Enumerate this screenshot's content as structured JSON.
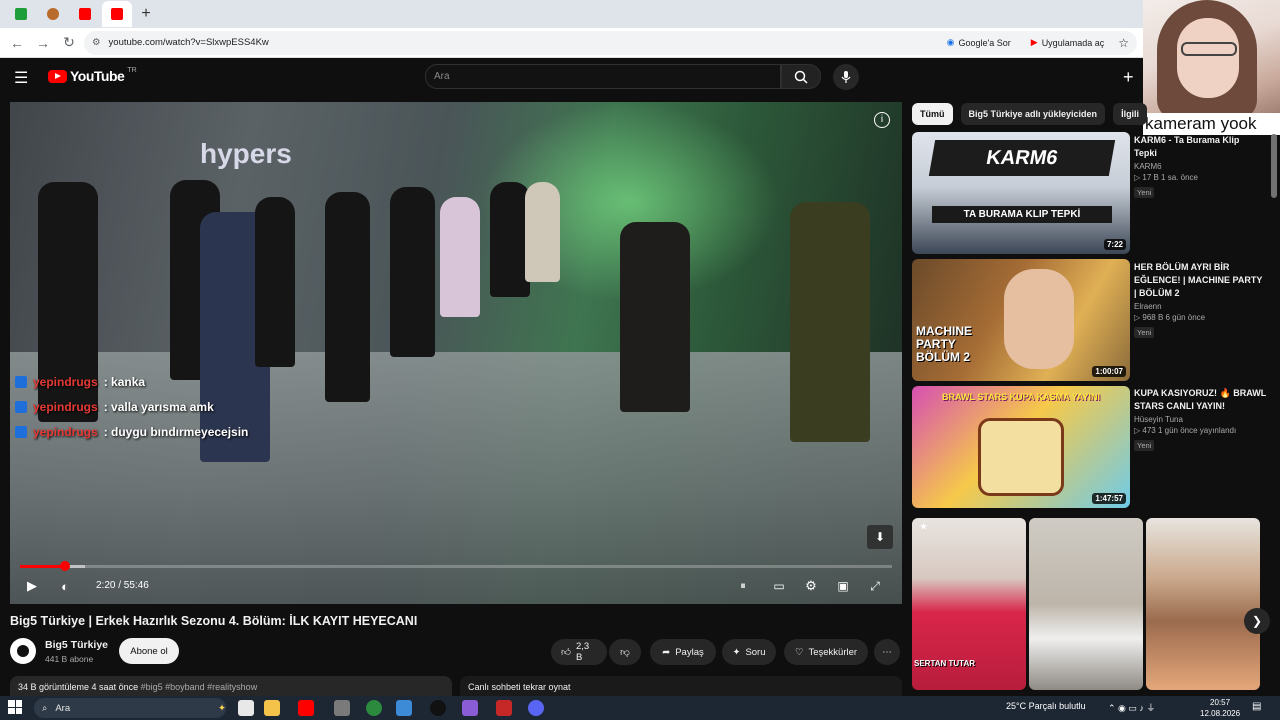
{
  "browser": {
    "url": "youtube.com/watch?v=SlxwpESS4Kw",
    "ask_google": "Google'a Sor",
    "open_in_app": "Uygulamada aç"
  },
  "webcam": {
    "overlay_text": "kameram yook"
  },
  "header": {
    "logo": "YouTube",
    "country_code": "TR",
    "search_placeholder": "Ara"
  },
  "player": {
    "time": "2:20 / 55:46",
    "progress": 0.042,
    "chat": [
      {
        "user": "yepindrugs",
        "message": ": kanka"
      },
      {
        "user": "yepindrugs",
        "message": ": valla yarısma amk"
      },
      {
        "user": "yepindrugs",
        "message": ": duygu bındırmeyecejsin"
      }
    ]
  },
  "video": {
    "title": "Big5 Türkiye | Erkek Hazırlık Sezonu 4. Bölüm: İLK KAYIT HEYECANI",
    "channel": "Big5 Türkiye",
    "subscribers": "441 B abone",
    "subscribe_label": "Abone ol",
    "likes": "2,3 B",
    "share": "Paylaş",
    "ask": "Soru",
    "thanks": "Teşekkürler",
    "views_time": "34 B görüntüleme  4 saat önce",
    "tags": "#big5 #boyband #realityshow",
    "chat_replay": "Canlı sohbeti tekrar oynat"
  },
  "chips": [
    "Tümü",
    "Big5 Türkiye adlı yükleyiciden",
    "İlgili"
  ],
  "recommendations": [
    {
      "title_line1": "KARM6 - Ta Burama Klip",
      "title_line2": "Tepki",
      "channel": "KARM6",
      "meta": "▷ 17 B   1 sa. önce",
      "badge": "Yeni",
      "duration": "7:22",
      "thumb_text": "TA BURAMA KLIP TEPKİ"
    },
    {
      "title_line1": "HER BÖLÜM AYRI BİR EĞLENCE! | MACHINE PARTY",
      "title_line2": "| BÖLÜM 2",
      "channel": "Elraenn",
      "meta": "▷ 968 B   6 gün önce",
      "badge": "Yeni",
      "duration": "1:00:07",
      "thumb_text": "MACHINE PARTY BÖLÜM 2"
    },
    {
      "title_line1": "KUPA KASIYORUZ! 🔥 BRAWL",
      "title_line2": "STARS CANLI YAYIN!",
      "channel": "Hüseyin Tuna",
      "meta": "▷ 473   1 gün önce yayınlandı",
      "badge": "Yeni",
      "duration": "1:47:57",
      "thumb_text": "BRAWL STARS KUPA KASMA YAYINI"
    }
  ],
  "shorts": [
    {
      "label": "SERTAN TUTAR"
    },
    {
      "label": ""
    },
    {
      "label": ""
    }
  ],
  "taskbar": {
    "search": "Ara",
    "weather": "25°C  Parçalı bulutlu",
    "time": "20:57",
    "date": "12.08.2026"
  },
  "colors": {
    "accent": "#ff0000",
    "background": "#0f0f0f"
  }
}
